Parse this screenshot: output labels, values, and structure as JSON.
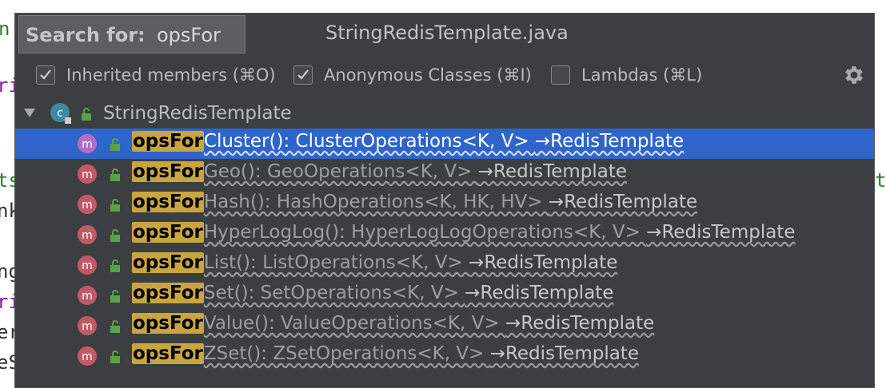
{
  "background_fragments": [
    {
      "text": "n",
      "color": "#2e7d32"
    },
    {
      "text": "ri",
      "color": "#7b1fa2"
    },
    {
      "text": "ts",
      "color": "#2e7d32"
    },
    {
      "text": "nk",
      "color": "#333333"
    },
    {
      "text": "ng",
      "color": "#333333"
    },
    {
      "text": "ri",
      "color": "#7b1fa2"
    },
    {
      "text": "er",
      "color": "#333333"
    },
    {
      "text": "eS",
      "color": "#333333"
    },
    {
      "text": "t",
      "color": "#2e7d32"
    }
  ],
  "header": {
    "search_label": "Search for:",
    "search_value": "opsFor",
    "file_title": "StringRedisTemplate.java"
  },
  "options": {
    "inherited": {
      "label": "Inherited members (⌘O)",
      "checked": true
    },
    "anonymous": {
      "label": "Anonymous Classes (⌘I)",
      "checked": true
    },
    "lambdas": {
      "label": "Lambdas (⌘L)",
      "checked": false
    }
  },
  "tree": {
    "root": {
      "label": "StringRedisTemplate",
      "icon": "class-icon"
    },
    "methods": [
      {
        "prefix": "opsFor",
        "name": "Cluster(): ClusterOperations<K, V>",
        "owner": "→RedisTemplate",
        "selected": true
      },
      {
        "prefix": "opsFor",
        "name": "Geo(): GeoOperations<K, V>",
        "owner": "→RedisTemplate",
        "selected": false
      },
      {
        "prefix": "opsFor",
        "name": "Hash(): HashOperations<K, HK, HV>",
        "owner": "→RedisTemplate",
        "selected": false
      },
      {
        "prefix": "opsFor",
        "name": "HyperLogLog(): HyperLogLogOperations<K, V>",
        "owner": "→RedisTemplate",
        "selected": false
      },
      {
        "prefix": "opsFor",
        "name": "List(): ListOperations<K, V>",
        "owner": "→RedisTemplate",
        "selected": false
      },
      {
        "prefix": "opsFor",
        "name": "Set(): SetOperations<K, V>",
        "owner": "→RedisTemplate",
        "selected": false
      },
      {
        "prefix": "opsFor",
        "name": "Value(): ValueOperations<K, V>",
        "owner": "→RedisTemplate",
        "selected": false
      },
      {
        "prefix": "opsFor",
        "name": "ZSet(): ZSetOperations<K, V>",
        "owner": "→RedisTemplate",
        "selected": false
      }
    ]
  },
  "colors": {
    "selection": "#2f65ca",
    "highlight": "#c9a540",
    "method_icon": "#c05a66",
    "method_icon_selected": "#b06fc4",
    "class_icon": "#3d8aa1",
    "lock": "#5aa24a"
  }
}
